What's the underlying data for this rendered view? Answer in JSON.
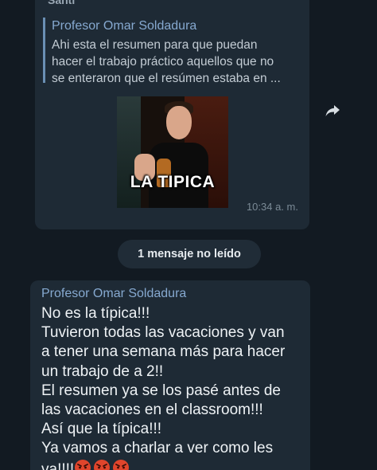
{
  "chat": {
    "first_message": {
      "sender": "Santi",
      "reply": {
        "author": "Profesor Omar Soldadura",
        "text": "Ahi esta el resumen para que puedan\nhacer el trabajo práctico aquellos que no\nse enteraron que el resúmen estaba en ..."
      },
      "sticker_caption": "LA TIPICA",
      "time": "10:34 a. m."
    },
    "unread_banner": "1 mensaje no leído",
    "second_message": {
      "sender": "Profesor Omar Soldadura",
      "text": "No es la típica!!!\nTuvieron todas las vacaciones y van\na tener una semana más para hacer\nun trabajo de a 2!!\nEl resumen ya se los pasé  antes de\nlas vacaciones en el classroom!!!\nAsí que la típica!!!\nYa vamos a charlar a ver como les\nva!!!!",
      "emoji": "angry-face-icon"
    }
  },
  "colors": {
    "background": "#121a22",
    "bubble": "#1e2a35",
    "name_accent": "#86a9d0",
    "quote_bar": "#6a8fb4"
  }
}
